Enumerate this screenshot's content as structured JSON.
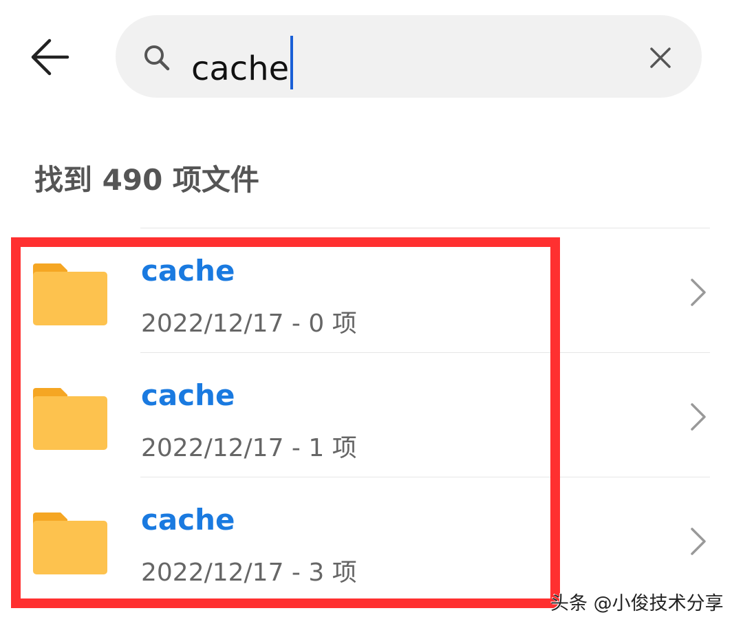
{
  "search": {
    "query": "cache",
    "back_icon": "arrow-left-icon",
    "search_icon": "search-icon",
    "clear_icon": "close-icon"
  },
  "results": {
    "count_label": "找到 490 项文件",
    "items": [
      {
        "name": "cache",
        "meta": "2022/12/17 - 0 项"
      },
      {
        "name": "cache",
        "meta": "2022/12/17 - 1 项"
      },
      {
        "name": "cache",
        "meta": "2022/12/17 - 3 项"
      }
    ]
  },
  "colors": {
    "accent": "#1a7ae0",
    "highlight_box": "#ff3030",
    "folder": "#fdc24e"
  },
  "watermark": "头条 @小俊技术分享"
}
